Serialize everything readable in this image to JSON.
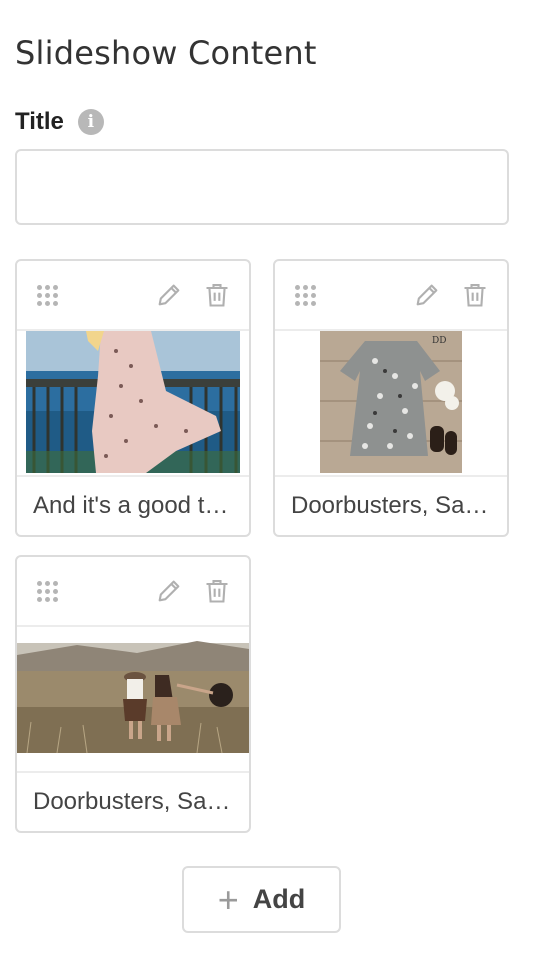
{
  "heading": "Slideshow Content",
  "title_field": {
    "label": "Title",
    "info_icon": "info-icon",
    "value": "",
    "placeholder": ""
  },
  "slides": [
    {
      "caption": "And it's a good time to shop!",
      "image": "woman-in-pink-dress-by-sea"
    },
    {
      "caption": "Doorbusters, Sale & More",
      "image": "printed-dress-flatlay"
    },
    {
      "caption": "Doorbusters, Sale & More",
      "image": "two-women-in-field"
    }
  ],
  "card_icons": {
    "drag": "drag-handle-icon",
    "edit": "pencil-icon",
    "delete": "trash-icon"
  },
  "add_button": {
    "label": "Add",
    "icon": "plus-icon"
  },
  "colors": {
    "border": "#dcdcdc",
    "icon_gray": "#b5b5b5",
    "text": "#444444"
  }
}
